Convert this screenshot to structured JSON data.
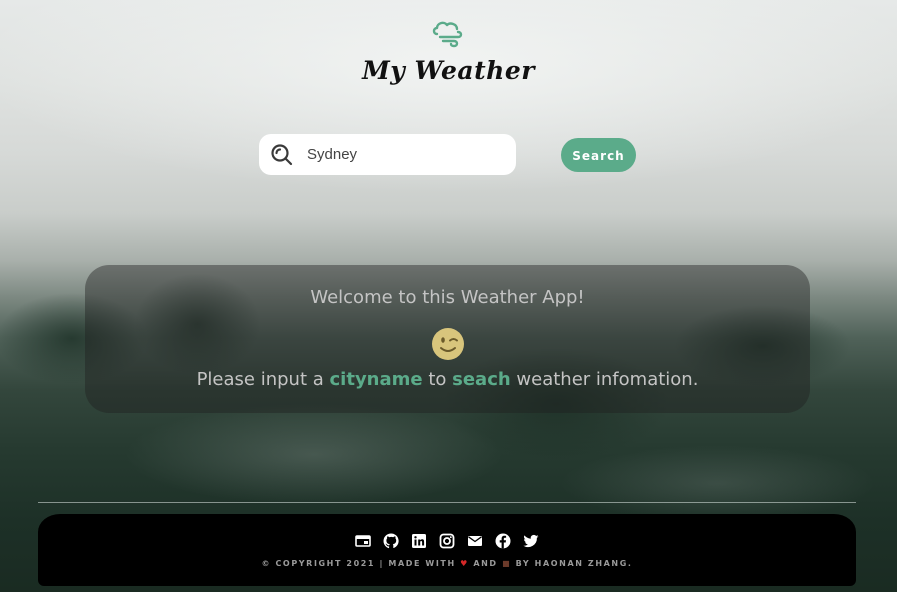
{
  "header": {
    "title": "My Weather",
    "logo_icon": "wind-icon",
    "accent_color": "#5bab8a"
  },
  "search": {
    "value": "Sydney",
    "placeholder": "Enter a city",
    "icon": "search-icon",
    "button_label": "Search"
  },
  "welcome": {
    "title": "Welcome to this Weather App!",
    "emoji_icon": "wink-emoji-icon",
    "message_before": "Please input a ",
    "highlight_1": "cityname",
    "message_middle": " to ",
    "highlight_2": "seach",
    "message_after": " weather infomation."
  },
  "footer": {
    "social_icons": [
      "website-icon",
      "github-icon",
      "linkedin-icon",
      "instagram-icon",
      "mail-icon",
      "facebook-icon",
      "twitter-icon"
    ],
    "copyright_before": "© COPYRIGHT 2021 | MADE WITH ",
    "heart_glyph": "♥",
    "copyright_and": " AND ",
    "cup_glyph": "■",
    "copyright_after": " BY HAONAN ZHANG."
  }
}
